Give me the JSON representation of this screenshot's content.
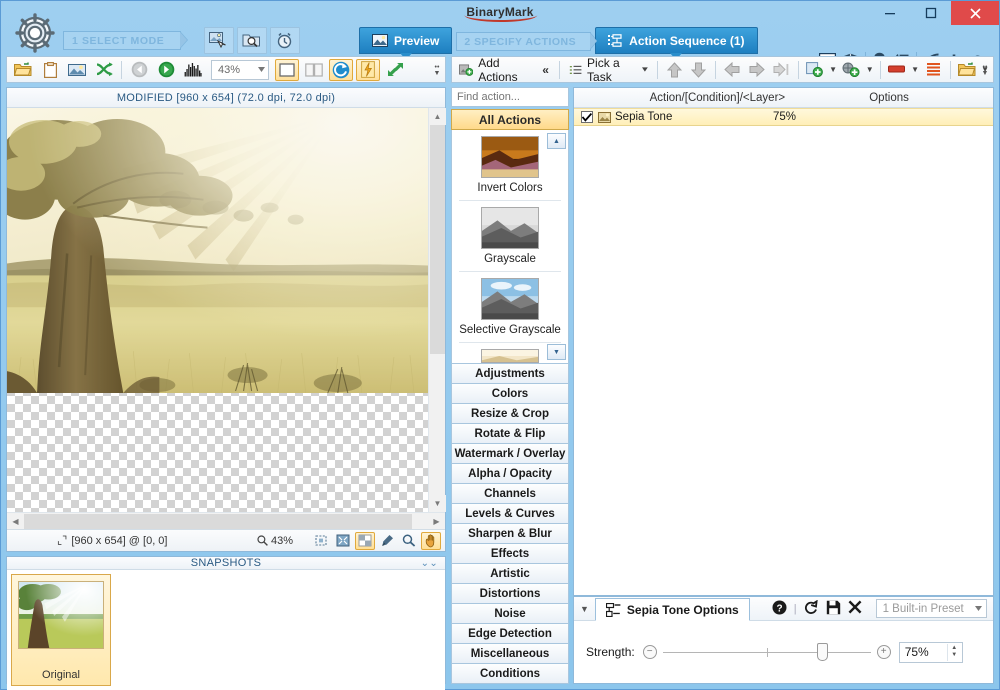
{
  "window": {
    "brand": "BinaryMark",
    "minimize_label": "Minimize",
    "maximize_label": "Maximize",
    "close_label": "Close"
  },
  "modebar": {
    "step1_label": "1 SELECT MODE",
    "mode_buttons": [
      "single-image-mode-icon",
      "batch-folder-mode-icon",
      "scheduled-mode-icon"
    ],
    "tabs": [
      {
        "label": "Preview",
        "icon": "image-preview-icon",
        "active": true
      },
      {
        "label": "2 SPECIFY ACTIONS",
        "step": true
      },
      {
        "label": "Action Sequence (1)",
        "icon": "action-sequence-icon",
        "active": true
      }
    ],
    "right_icons": [
      "console-icon",
      "shield-icon",
      "tips-lightbulb-icon",
      "checklist-icon",
      "wifi-updates-icon",
      "plus-icon",
      "help-question-icon"
    ]
  },
  "image_toolbar": {
    "buttons": [
      "open-file-icon",
      "paste-clipboard-icon",
      "save-image-icon",
      "shuffle-icon",
      "undo-back-icon",
      "redo-forward-icon",
      "histogram-icon"
    ],
    "zoom_value": "43%",
    "view_buttons": [
      "single-view-icon",
      "split-view-icon",
      "refresh-icon",
      "auto-apply-icon",
      "fit-icon"
    ]
  },
  "preview": {
    "header": "MODIFIED [960 x 654] (72.0 dpi, 72.0 dpi)",
    "status_coords": "[960 x 654] @ [0, 0]",
    "status_zoom": "43%",
    "status_buttons": [
      "fit-to-window-icon",
      "actual-size-icon",
      "transparency-icon",
      "eyedropper-icon",
      "zoom-tool-icon",
      "pan-tool-icon"
    ]
  },
  "snapshots": {
    "header": "SNAPSHOTS",
    "items": [
      {
        "label": "Original"
      }
    ]
  },
  "action_toolbar": {
    "add_actions_label": "Add Actions",
    "collapse_label": "«",
    "pick_task_label": "Pick a Task",
    "buttons": [
      "move-up-icon",
      "move-down-icon",
      "move-left-icon",
      "move-right-icon",
      "move-end-icon",
      "add-action-icon",
      "add-group-icon",
      "remove-icon",
      "list-icon",
      "open-sequence-icon"
    ]
  },
  "action_picker": {
    "find_placeholder": "Find action...",
    "browse_icon": "browse-actions-icon",
    "all_actions_label": "All Actions",
    "thumbnails": [
      {
        "label": "Invert Colors",
        "icon": "invert-colors-thumb"
      },
      {
        "label": "Grayscale",
        "icon": "grayscale-thumb"
      },
      {
        "label": "Selective Grayscale",
        "icon": "selective-grayscale-thumb"
      }
    ],
    "categories": [
      "Adjustments",
      "Colors",
      "Resize & Crop",
      "Rotate & Flip",
      "Watermark / Overlay",
      "Alpha / Opacity",
      "Channels",
      "Levels & Curves",
      "Sharpen & Blur",
      "Effects",
      "Artistic",
      "Distortions",
      "Noise",
      "Edge Detection",
      "Miscellaneous",
      "Conditions"
    ]
  },
  "sequence": {
    "columns": {
      "col_action": "Action/[Condition]/<Layer>",
      "col_options": "Options"
    },
    "rows": [
      {
        "checked": true,
        "name": "Sepia Tone",
        "options": "75%"
      }
    ]
  },
  "options_panel": {
    "title": "Sepia Tone Options",
    "icon": "options-node-icon",
    "toolbar_icons": [
      "help-icon",
      "reset-icon",
      "save-preset-icon",
      "delete-preset-icon"
    ],
    "preset_value": "1 Built-in Preset",
    "strength_label": "Strength:",
    "strength_value": "75%",
    "strength_percent": 75
  },
  "colors": {
    "window_blue": "#8cc6ec",
    "accent_amber": "#ffd98a",
    "tab_active": "#2b8ecb",
    "close_red": "#e04a4a",
    "sepia_light": "#f5efc9",
    "sepia_dark": "#6b5a33"
  }
}
